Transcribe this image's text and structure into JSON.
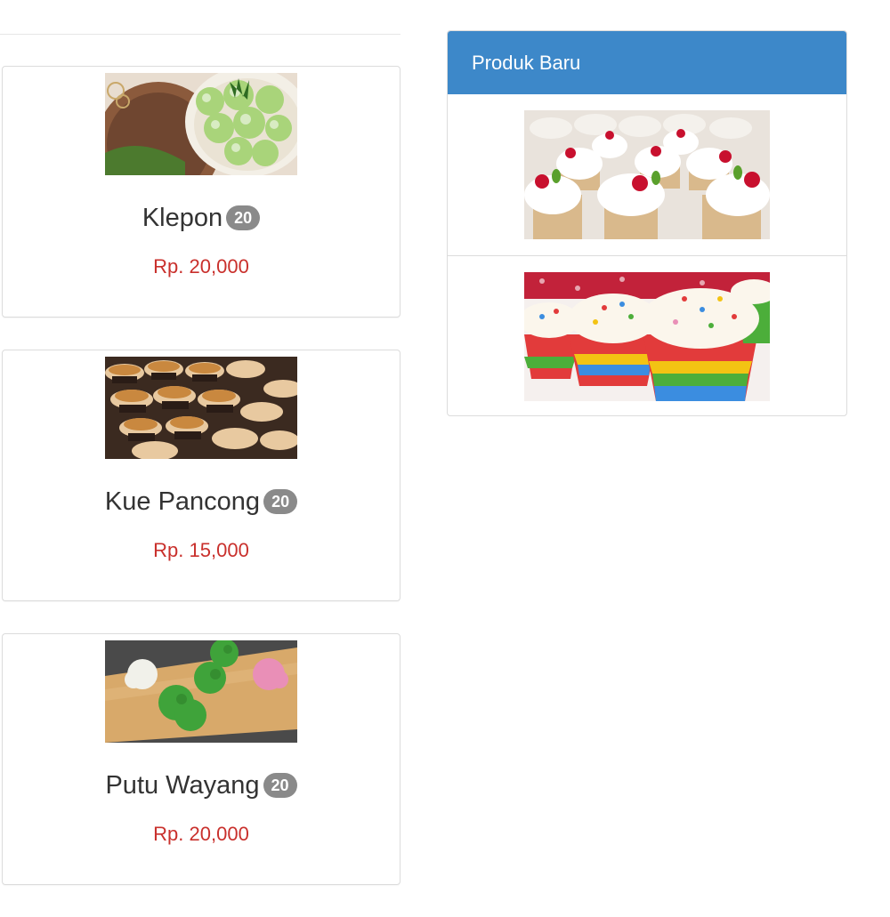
{
  "products": [
    {
      "name": "Klepon",
      "badge": "20",
      "price": "Rp. 20,000",
      "image": "klepon-image"
    },
    {
      "name": "Kue Pancong",
      "badge": "20",
      "price": "Rp. 15,000",
      "image": "kue-pancong-image"
    },
    {
      "name": "Putu Wayang",
      "badge": "20",
      "price": "Rp. 20,000",
      "image": "putu-wayang-image"
    }
  ],
  "sidebar": {
    "heading": "Produk Baru",
    "items": [
      {
        "image": "strawberry-cupcakes-image"
      },
      {
        "image": "rainbow-cupcakes-image"
      }
    ]
  },
  "colors": {
    "panel_heading": "#3d88c9",
    "price": "#c9302c",
    "badge": "#8a8a8a"
  }
}
